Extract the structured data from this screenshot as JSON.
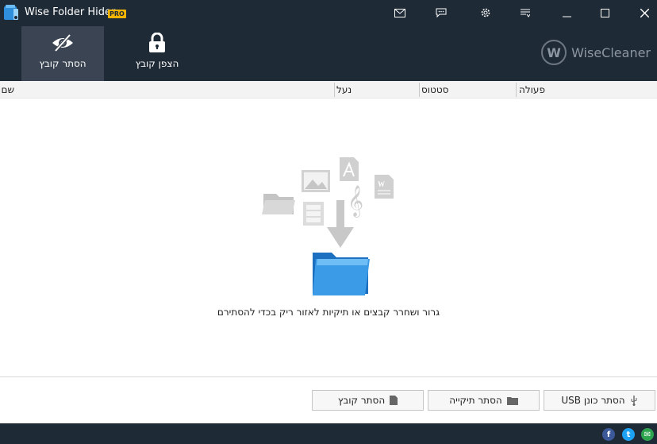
{
  "app": {
    "title": "Wise Folder Hider",
    "badge": "PRO",
    "brand": "WiseCleaner",
    "brand_mark": "W"
  },
  "tabs": [
    {
      "label": "הסתר קובץ",
      "icon": "eye-slash-icon",
      "active": true
    },
    {
      "label": "הצפן קובץ",
      "icon": "lock-icon",
      "active": false
    }
  ],
  "titlebar_icons": [
    "mail-icon",
    "chat-icon",
    "gear-icon",
    "menu-icon",
    "minimize-icon",
    "maximize-icon",
    "close-icon"
  ],
  "columns": {
    "name": "שם",
    "lock": "נעל",
    "status": "סטטוס",
    "action": "פעולה"
  },
  "hint": "גרור ושחרר קבצים או תיקיות לאזור ריק בכדי להסתירם",
  "buttons": {
    "hide_file": "הסתר קובץ",
    "hide_folder": "הסתר תיקייה",
    "hide_usb": "הסתר כונן USB"
  },
  "social": {
    "facebook": "f",
    "twitter": "t",
    "email": "✉"
  },
  "colors": {
    "header": "#1f2a37",
    "active_tab": "#3a4452",
    "pro_badge": "#f4b400",
    "facebook": "#3b5998",
    "twitter": "#1da1f2",
    "email": "#2ea44f"
  }
}
